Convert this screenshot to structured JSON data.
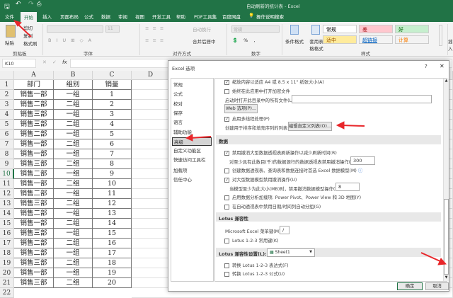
{
  "window": {
    "title": "自动刷新的统计表 - Excel"
  },
  "tabs": [
    "文件",
    "开始",
    "插入",
    "页面布局",
    "公式",
    "数据",
    "审阅",
    "视图",
    "开发工具",
    "帮助",
    "PDF工具集",
    "百度网盘",
    "操作说明搜索"
  ],
  "ribbon": {
    "clipboard": {
      "paste": "粘贴",
      "cut": "剪切",
      "copy": "复制",
      "format_painter": "格式刷",
      "label": "剪贴板"
    },
    "font": {
      "size": "11",
      "label": "字体"
    },
    "alignment": {
      "wrap": "自动换行",
      "merge": "合并后居中",
      "label": "对齐方式"
    },
    "number": {
      "format": "常规",
      "label": "数字"
    },
    "styles": {
      "conditional": "条件格式",
      "table": "套用表格格式",
      "label": "样式",
      "cells": [
        {
          "text": "常规",
          "bg": "#ffffff",
          "color": "#000000"
        },
        {
          "text": "差",
          "bg": "#ffc7ce",
          "color": "#9c0006"
        },
        {
          "text": "好",
          "bg": "#c6efce",
          "color": "#006100"
        },
        {
          "text": "适中",
          "bg": "#ffeb9c",
          "color": "#9c5700"
        },
        {
          "text": "超链接",
          "bg": "#f3f3f3",
          "color": "#0563c1"
        },
        {
          "text": "计算",
          "bg": "#f2f2f2",
          "color": "#fa7d00"
        }
      ]
    },
    "cells": {
      "insert": "插入"
    }
  },
  "formula_bar": {
    "name_box": "K10",
    "fx": "fx"
  },
  "sheet": {
    "columns": [
      "A",
      "B",
      "C",
      "D"
    ],
    "rows": [
      [
        "部门",
        "组别",
        "销量"
      ],
      [
        "销售一部",
        "一组",
        "1"
      ],
      [
        "销售二部",
        "二组",
        "2"
      ],
      [
        "销售三部",
        "一组",
        "3"
      ],
      [
        "销售三部",
        "二组",
        "4"
      ],
      [
        "销售二部",
        "一组",
        "5"
      ],
      [
        "销售一部",
        "二组",
        "6"
      ],
      [
        "销售一部",
        "一组",
        "7"
      ],
      [
        "销售三部",
        "二组",
        "8"
      ],
      [
        "销售二部",
        "一组",
        "9"
      ],
      [
        "销售一部",
        "二组",
        "10"
      ],
      [
        "销售二部",
        "一组",
        "11"
      ],
      [
        "销售三部",
        "二组",
        "12"
      ],
      [
        "销售二部",
        "一组",
        "13"
      ],
      [
        "销售一部",
        "二组",
        "14"
      ],
      [
        "销售三部",
        "一组",
        "15"
      ],
      [
        "销售二部",
        "二组",
        "16"
      ],
      [
        "销售二部",
        "一组",
        "17"
      ],
      [
        "销售三部",
        "二组",
        "18"
      ],
      [
        "销售一部",
        "一组",
        "19"
      ],
      [
        "销售三部",
        "二组",
        "20"
      ]
    ]
  },
  "dialog": {
    "title": "Excel 选项",
    "help": "?",
    "close": "✕",
    "nav": [
      "常规",
      "公式",
      "校对",
      "保存",
      "语言",
      "辅助功能",
      "高级",
      "自定义功能区",
      "快速访问工具栏",
      "加载项",
      "信任中心"
    ],
    "selected_nav": "高级",
    "options": {
      "scale_a4": {
        "label": "缩放内容以适应 A4 或 8.5 x 11\" 纸张大小(A)",
        "checked": true
      },
      "open_encrypted": {
        "label": "始终在此应用中打开加密文件",
        "checked": false
      },
      "startup_folder_label": "启动时打开此目录中的所有文件(L):",
      "startup_folder_value": "",
      "web_options": "Web 选项(P)...",
      "multithread": {
        "label": "启用多线程处理(P)",
        "checked": true
      },
      "custom_lists_label": "创建用于排序和填充序列的列表:",
      "custom_lists_button": "编辑自定义列表(O)...",
      "data_section": "数据",
      "disable_undo_pivot": {
        "label": "禁用撤消大型数据透视表刷新操作以减少刷新时间(R)",
        "checked": true
      },
      "pivot_rows_label": "对至少具有此数目(千)的数据源行的数据透视表禁用撤消操作(N):",
      "pivot_rows_value": "300",
      "prefer_data_model": {
        "label": "创建数据透视表、查询表和数据连接时首选 Excel 数据模型(M)",
        "checked": false
      },
      "disable_undo_model": {
        "label": "对大型数据模型禁用撤消操作(U)",
        "checked": true
      },
      "model_size_label": "当模型至少为此大小(MB)时，禁用撤消数据模型操作(L):",
      "model_size_value": "8",
      "enable_addins": {
        "label": "启用数据分析加载项: Power Pivot、Power View 和 3D 地图(Y)",
        "checked": false
      },
      "disable_date_group": {
        "label": "在自动透视表中禁用日期/时间列自动分组(G)",
        "checked": false
      },
      "lotus_section": "Lotus 兼容性",
      "menu_key_label": "Microsoft Excel 菜单键(M):",
      "menu_key_value": "/",
      "lotus_nav_keys": {
        "label": "Lotus 1-2-3 常用键(K)",
        "checked": false
      },
      "lotus_settings_label": "Lotus 兼容性设置(L):",
      "lotus_settings_value": "Sheet1",
      "convert_expr": {
        "label": "转换 Lotus 1-2-3 表达式(F)",
        "checked": false
      },
      "convert_formula": {
        "label": "转换 Lotus 1-2-3 公式(U)",
        "checked": false
      }
    },
    "ok": "确定",
    "cancel": "取消"
  },
  "accent": "#217346",
  "annotation_color": "#e8262a"
}
